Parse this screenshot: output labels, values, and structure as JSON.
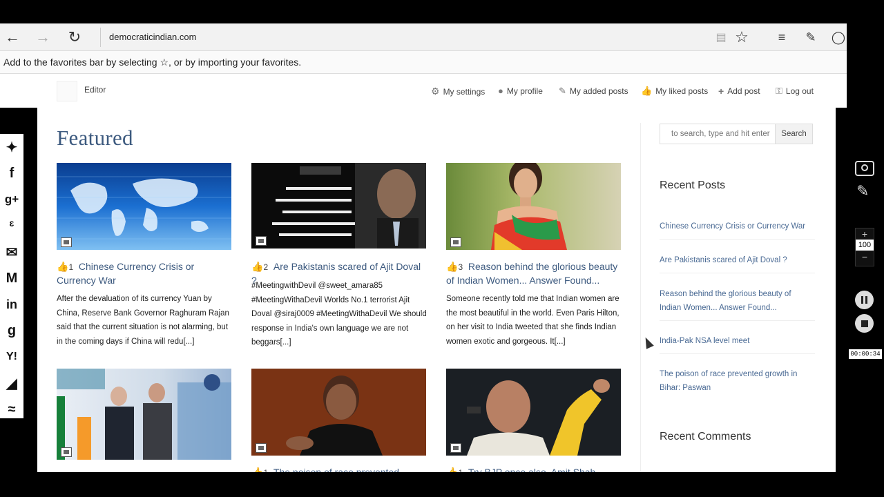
{
  "browser": {
    "url": "democraticindian.com",
    "favorites_hint": "Add to the favorites bar by selecting ☆, or by importing your favorites."
  },
  "wp_toolbar": {
    "user": "Editor",
    "items": [
      {
        "label": "My settings",
        "icon": "gear-icon"
      },
      {
        "label": "My profile",
        "icon": "user-icon"
      },
      {
        "label": "My added posts",
        "icon": "pencil-icon"
      },
      {
        "label": "My liked posts",
        "icon": "thumbs-up-icon"
      },
      {
        "label": "Add post",
        "icon": "plus-icon"
      },
      {
        "label": "Log out",
        "icon": "key-icon"
      }
    ]
  },
  "main": {
    "heading": "Featured",
    "posts": [
      {
        "likes": "1",
        "title": "Chinese Currency Crisis or Currency War",
        "excerpt": "After the devaluation of its currency Yuan by China, Reserve Bank Governor Raghuram Rajan said that the current situation is not alarming, but in the coming days if China will redu[...]"
      },
      {
        "likes": "2",
        "title": "Are Pakistanis scared of Ajit Doval ?",
        "excerpt": "#MeetingwithDevil @sweet_amara85 #MeetingWithaDevil Worlds No.1 terrorist Ajit Doval @siraj0009 #MeetingWithaDevil We should response in India's own language we are not beggars[...]"
      },
      {
        "likes": "3",
        "title": "Reason behind the glorious beauty of Indian Women... Answer Found...",
        "excerpt": "Someone recently told me that Indian women are the most beautiful in the world. Even Paris Hilton, on her visit to India tweeted that she finds Indian women exotic and gorgeous. It[...]"
      }
    ],
    "second_row_titles": [
      "The poison of race prevented growth",
      "Try BJP once also, Amit Shah"
    ],
    "second_row_likes": [
      "1",
      "1"
    ]
  },
  "sidebar": {
    "search_placeholder": "to search, type and hit enter",
    "search_button": "Search",
    "recent_posts_heading": "Recent Posts",
    "recent_posts": [
      "Chinese Currency Crisis or Currency War",
      "Are Pakistanis scared of Ajit Doval ?",
      "Reason behind the glorious beauty of Indian Women... Answer Found...",
      "India-Pak NSA level meet",
      "The poison of race prevented growth in Bihar: Paswan"
    ],
    "recent_comments_heading": "Recent Comments"
  },
  "recorder": {
    "zoom": "100",
    "timer": "00:00:34"
  }
}
